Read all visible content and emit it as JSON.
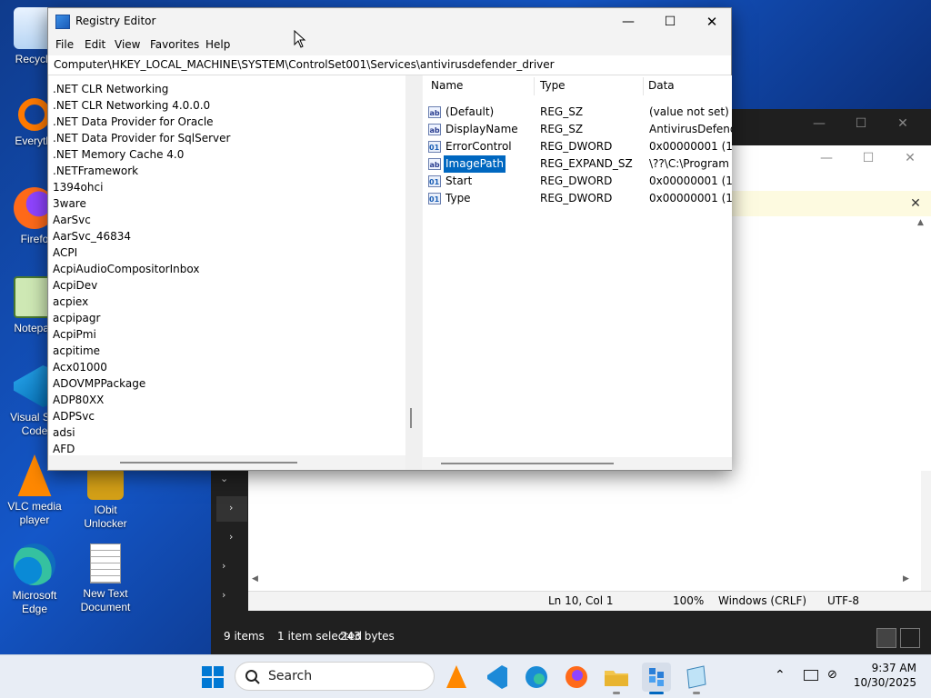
{
  "desktop": {
    "icons": [
      {
        "label": "Recycle"
      },
      {
        "label": "Everythi"
      },
      {
        "label": "Firefo"
      },
      {
        "label": "Notepad"
      },
      {
        "label": "Visual Stu\nCode"
      },
      {
        "label": "VLC media player"
      },
      {
        "label": "IObit Unlocker"
      },
      {
        "label": "Microsoft Edge"
      },
      {
        "label": "New Text Document"
      }
    ]
  },
  "regedit": {
    "title": "Registry Editor",
    "menu": [
      "File",
      "Edit",
      "View",
      "Favorites",
      "Help"
    ],
    "address": "Computer\\HKEY_LOCAL_MACHINE\\SYSTEM\\ControlSet001\\Services\\antivirusdefender_driver",
    "tree": [
      ".NET CLR Networking",
      ".NET CLR Networking 4.0.0.0",
      ".NET Data Provider for Oracle",
      ".NET Data Provider for SqlServer",
      ".NET Memory Cache 4.0",
      ".NETFramework",
      "1394ohci",
      "3ware",
      "AarSvc",
      "AarSvc_46834",
      "ACPI",
      "AcpiAudioCompositorInbox",
      "AcpiDev",
      "acpiex",
      "acpipagr",
      "AcpiPmi",
      "acpitime",
      "Acx01000",
      "ADOVMPPackage",
      "ADP80XX",
      "ADPSvc",
      "adsi",
      "AFD"
    ],
    "columns": {
      "name": "Name",
      "type": "Type",
      "data": "Data"
    },
    "values": [
      {
        "icon": "ab",
        "name": "(Default)",
        "type": "REG_SZ",
        "data": "(value not set)"
      },
      {
        "icon": "ab",
        "name": "DisplayName",
        "type": "REG_SZ",
        "data": "AntivirusDefende"
      },
      {
        "icon": "bin",
        "name": "ErrorControl",
        "type": "REG_DWORD",
        "data": "0x00000001 (1)"
      },
      {
        "icon": "ab",
        "name": "ImagePath",
        "type": "REG_EXPAND_SZ",
        "data": "\\??\\C:\\Program F"
      },
      {
        "icon": "bin",
        "name": "Start",
        "type": "REG_DWORD",
        "data": "0x00000001 (1)"
      },
      {
        "icon": "bin",
        "name": "Type",
        "type": "REG_DWORD",
        "data": "0x00000001 (1)"
      }
    ],
    "selected_value": "ImagePath"
  },
  "notepad": {
    "status": {
      "position": "Ln 10, Col 1",
      "zoom": "100%",
      "eol": "Windows (CRLF)",
      "encoding": "UTF-8"
    }
  },
  "explorer": {
    "status": {
      "items": "9 items",
      "selected": "1 item selected",
      "size": "243 bytes"
    }
  },
  "taskbar": {
    "search_label": "Search",
    "time": "9:37 AM",
    "date": "10/30/2025"
  },
  "colors": {
    "selection": "#0067c0",
    "desktop": "#1457c9"
  }
}
